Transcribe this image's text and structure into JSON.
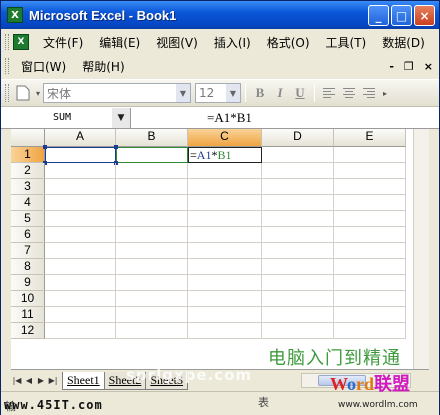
{
  "window": {
    "title": "Microsoft Excel - Book1",
    "icon_label": "X"
  },
  "menu": {
    "row1": [
      "文件(F)",
      "编辑(E)",
      "视图(V)",
      "插入(I)",
      "格式(O)",
      "工具(T)",
      "数据(D)"
    ],
    "row2": [
      "窗口(W)",
      "帮助(H)"
    ],
    "right_controls": [
      "-",
      "❐",
      "×"
    ]
  },
  "toolbar": {
    "font_name": "宋体",
    "font_size": "12",
    "bold": "B",
    "italic": "I",
    "underline": "U"
  },
  "formula_bar": {
    "name_box": "SUM",
    "formula": "=A1*B1"
  },
  "grid": {
    "columns": [
      "A",
      "B",
      "C",
      "D",
      "E"
    ],
    "rows": [
      "1",
      "2",
      "3",
      "4",
      "5",
      "6",
      "7",
      "8",
      "9",
      "10",
      "11",
      "12"
    ],
    "active_column": "C",
    "active_row": "1",
    "cell_c1": {
      "prefix": "=",
      "ref1": "A1",
      "op": "*",
      "ref2": "B1"
    }
  },
  "sheets": [
    "Sheet1",
    "Sheet2",
    "Sheet3"
  ],
  "status": {
    "left": "输",
    "ghost": "表"
  },
  "watermarks": {
    "site1": "www.45IT.com",
    "site2_cn": "电脑入门到精通",
    "logo_w": "W",
    "logo_o": "o",
    "logo_rd": "rd",
    "logo_cn": "联盟",
    "site3": "www.wordlm.com",
    "mid": "sprlgxpe.com"
  },
  "colors": {
    "titlebar": "#0a57d8",
    "active_header": "#f0a442",
    "ref_blue": "#1b3c94",
    "ref_green": "#2f8a38"
  }
}
